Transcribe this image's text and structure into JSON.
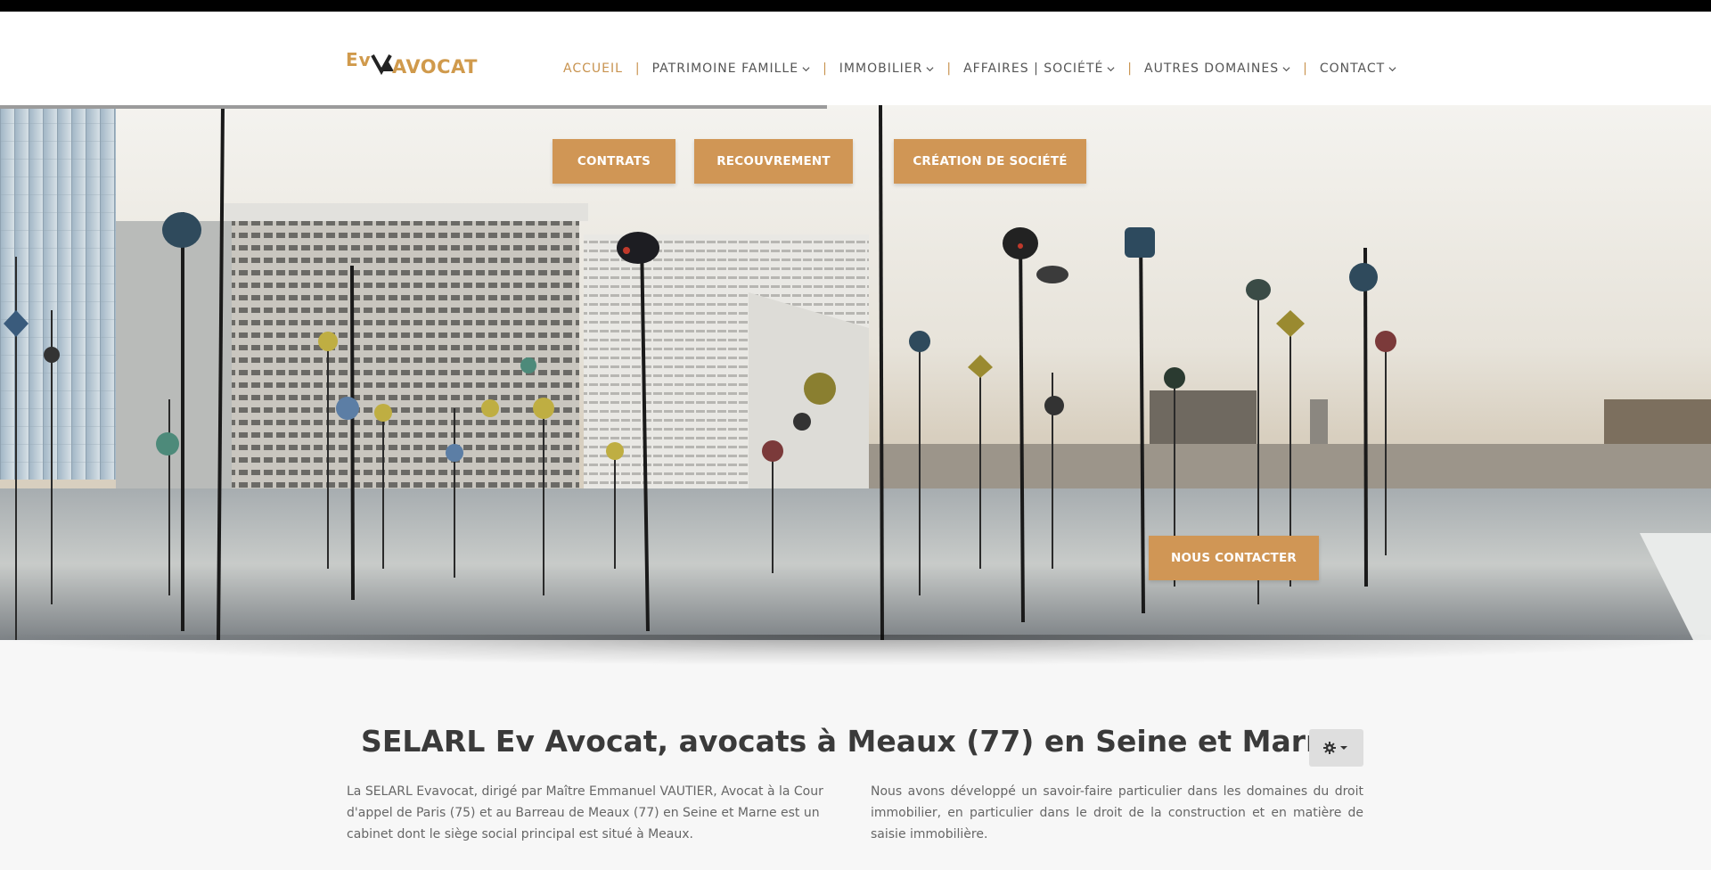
{
  "brand": {
    "logo_text_left": "Ev",
    "logo_text_right": "AVOCAT",
    "accent_color": "#d09655"
  },
  "nav": {
    "items": [
      {
        "label": "ACCUEIL",
        "active": true,
        "has_dropdown": false
      },
      {
        "label": "PATRIMOINE FAMILLE",
        "active": false,
        "has_dropdown": true
      },
      {
        "label": "IMMOBILIER",
        "active": false,
        "has_dropdown": true
      },
      {
        "label": "AFFAIRES | SOCIÉTÉ",
        "active": false,
        "has_dropdown": true
      },
      {
        "label": "AUTRES DOMAINES",
        "active": false,
        "has_dropdown": true
      },
      {
        "label": "CONTACT",
        "active": false,
        "has_dropdown": true
      }
    ],
    "separator": "|"
  },
  "hero": {
    "buttons": {
      "contrats": "CONTRATS",
      "recouvrement": "RECOUVREMENT",
      "creation": "CRÉATION DE SOCIÉTÉ",
      "contact": "NOUS CONTACTER"
    }
  },
  "main": {
    "title": "SELARL Ev Avocat, avocats à Meaux (77) en Seine et Marne",
    "settings_icon": "gear-icon",
    "left_paragraph": "La SELARL Evavocat, dirigé par Maître Emmanuel VAUTIER, Avocat à la Cour d'appel de Paris (75) et au Barreau de Meaux (77) en Seine et Marne est un cabinet dont le siège social principal est situé à Meaux.",
    "right_paragraph": "Nous avons développé un savoir-faire particulier dans les domaines du droit immobilier, en particulier dans le droit de la construction et en matière de saisie immobilière."
  }
}
